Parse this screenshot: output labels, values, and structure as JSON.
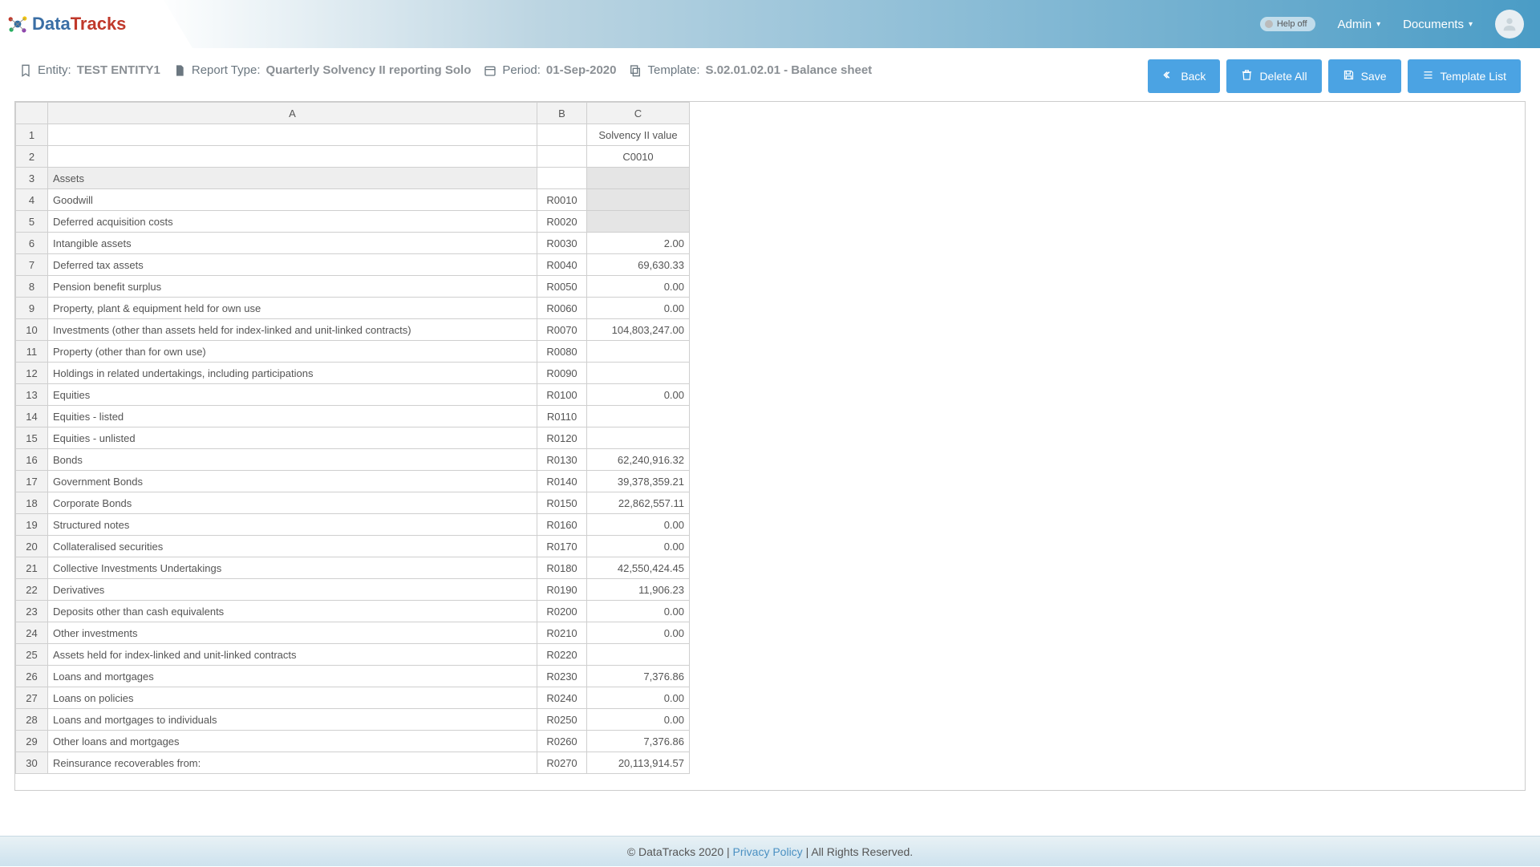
{
  "header": {
    "logo_prefix": "Data",
    "logo_suffix": "Tracks",
    "help_label": "Help off",
    "nav_admin": "Admin",
    "nav_documents": "Documents"
  },
  "meta": {
    "entity_lbl": "Entity:",
    "entity_val": "TEST ENTITY1",
    "report_lbl": "Report Type:",
    "report_val": "Quarterly Solvency II reporting Solo",
    "period_lbl": "Period:",
    "period_val": "01-Sep-2020",
    "template_lbl": "Template:",
    "template_val": "S.02.01.02.01 - Balance sheet"
  },
  "buttons": {
    "back": "Back",
    "delete": "Delete All",
    "save": "Save",
    "templates": "Template List"
  },
  "columns": {
    "A": "A",
    "B": "B",
    "C": "C"
  },
  "hdr_c": "Solvency II value",
  "hdr_code": "C0010",
  "rows": [
    {
      "n": "3",
      "label": "Assets",
      "ind": 1,
      "code": "",
      "val": "",
      "sect": true,
      "grey": true
    },
    {
      "n": "4",
      "label": "Goodwill",
      "ind": 2,
      "code": "R0010",
      "val": "",
      "grey": true
    },
    {
      "n": "5",
      "label": "Deferred acquisition costs",
      "ind": 2,
      "code": "R0020",
      "val": "",
      "grey": true
    },
    {
      "n": "6",
      "label": "Intangible assets",
      "ind": 2,
      "code": "R0030",
      "val": "2.00"
    },
    {
      "n": "7",
      "label": "Deferred tax assets",
      "ind": 2,
      "code": "R0040",
      "val": "69,630.33"
    },
    {
      "n": "8",
      "label": "Pension benefit surplus",
      "ind": 2,
      "code": "R0050",
      "val": "0.00"
    },
    {
      "n": "9",
      "label": "Property, plant & equipment held for own use",
      "ind": 2,
      "code": "R0060",
      "val": "0.00"
    },
    {
      "n": "10",
      "label": "Investments (other than assets held for index-linked and unit-linked contracts)",
      "ind": 2,
      "code": "R0070",
      "val": "104,803,247.00"
    },
    {
      "n": "11",
      "label": "Property (other than for own use)",
      "ind": 3,
      "code": "R0080",
      "val": ""
    },
    {
      "n": "12",
      "label": "Holdings in related undertakings, including participations",
      "ind": 3,
      "code": "R0090",
      "val": ""
    },
    {
      "n": "13",
      "label": "Equities",
      "ind": 3,
      "code": "R0100",
      "val": "0.00"
    },
    {
      "n": "14",
      "label": "Equities - listed",
      "ind": 4,
      "code": "R0110",
      "val": ""
    },
    {
      "n": "15",
      "label": "Equities - unlisted",
      "ind": 4,
      "code": "R0120",
      "val": ""
    },
    {
      "n": "16",
      "label": "Bonds",
      "ind": 3,
      "code": "R0130",
      "val": "62,240,916.32"
    },
    {
      "n": "17",
      "label": "Government Bonds",
      "ind": 4,
      "code": "R0140",
      "val": "39,378,359.21"
    },
    {
      "n": "18",
      "label": "Corporate Bonds",
      "ind": 4,
      "code": "R0150",
      "val": "22,862,557.11"
    },
    {
      "n": "19",
      "label": "Structured notes",
      "ind": 4,
      "code": "R0160",
      "val": "0.00"
    },
    {
      "n": "20",
      "label": "Collateralised securities",
      "ind": 4,
      "code": "R0170",
      "val": "0.00"
    },
    {
      "n": "21",
      "label": "Collective Investments Undertakings",
      "ind": 3,
      "code": "R0180",
      "val": "42,550,424.45"
    },
    {
      "n": "22",
      "label": "Derivatives",
      "ind": 3,
      "code": "R0190",
      "val": "11,906.23"
    },
    {
      "n": "23",
      "label": "Deposits other than cash equivalents",
      "ind": 3,
      "code": "R0200",
      "val": "0.00"
    },
    {
      "n": "24",
      "label": "Other investments",
      "ind": 3,
      "code": "R0210",
      "val": "0.00"
    },
    {
      "n": "25",
      "label": "Assets held for index-linked and unit-linked contracts",
      "ind": 2,
      "code": "R0220",
      "val": ""
    },
    {
      "n": "26",
      "label": "Loans and mortgages",
      "ind": 2,
      "code": "R0230",
      "val": "7,376.86"
    },
    {
      "n": "27",
      "label": "Loans on policies",
      "ind": 3,
      "code": "R0240",
      "val": "0.00"
    },
    {
      "n": "28",
      "label": "Loans and mortgages to individuals",
      "ind": 3,
      "code": "R0250",
      "val": "0.00"
    },
    {
      "n": "29",
      "label": "Other loans and mortgages",
      "ind": 3,
      "code": "R0260",
      "val": "7,376.86"
    },
    {
      "n": "30",
      "label": "Reinsurance recoverables from:",
      "ind": 2,
      "code": "R0270",
      "val": "20,113,914.57"
    }
  ],
  "footer": {
    "copyright": "© DataTracks 2020 | ",
    "privacy": "Privacy Policy",
    "rights": " | All Rights Reserved."
  }
}
